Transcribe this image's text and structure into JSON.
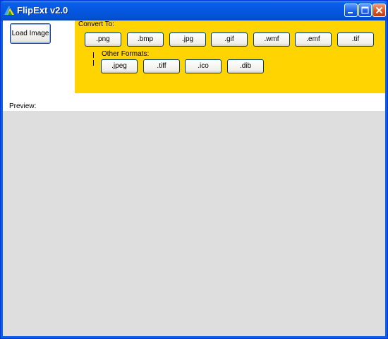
{
  "window": {
    "title": "FlipExt v2.0"
  },
  "load_button": {
    "label": "Load Image"
  },
  "convert": {
    "label": "Convert To:",
    "formats": [
      ".png",
      ".bmp",
      ".jpg",
      ".gif",
      ".wmf",
      ".emf",
      ".tif"
    ],
    "other_label": "Other Formats:",
    "other_formats": [
      ".jpeg",
      ".tiff",
      ".ico",
      ".dib"
    ],
    "panel_color": "#ffd400"
  },
  "preview": {
    "label": "Preview:"
  },
  "colors": {
    "titlebar": "#0a5fe8",
    "preview_bg": "#dedede"
  }
}
